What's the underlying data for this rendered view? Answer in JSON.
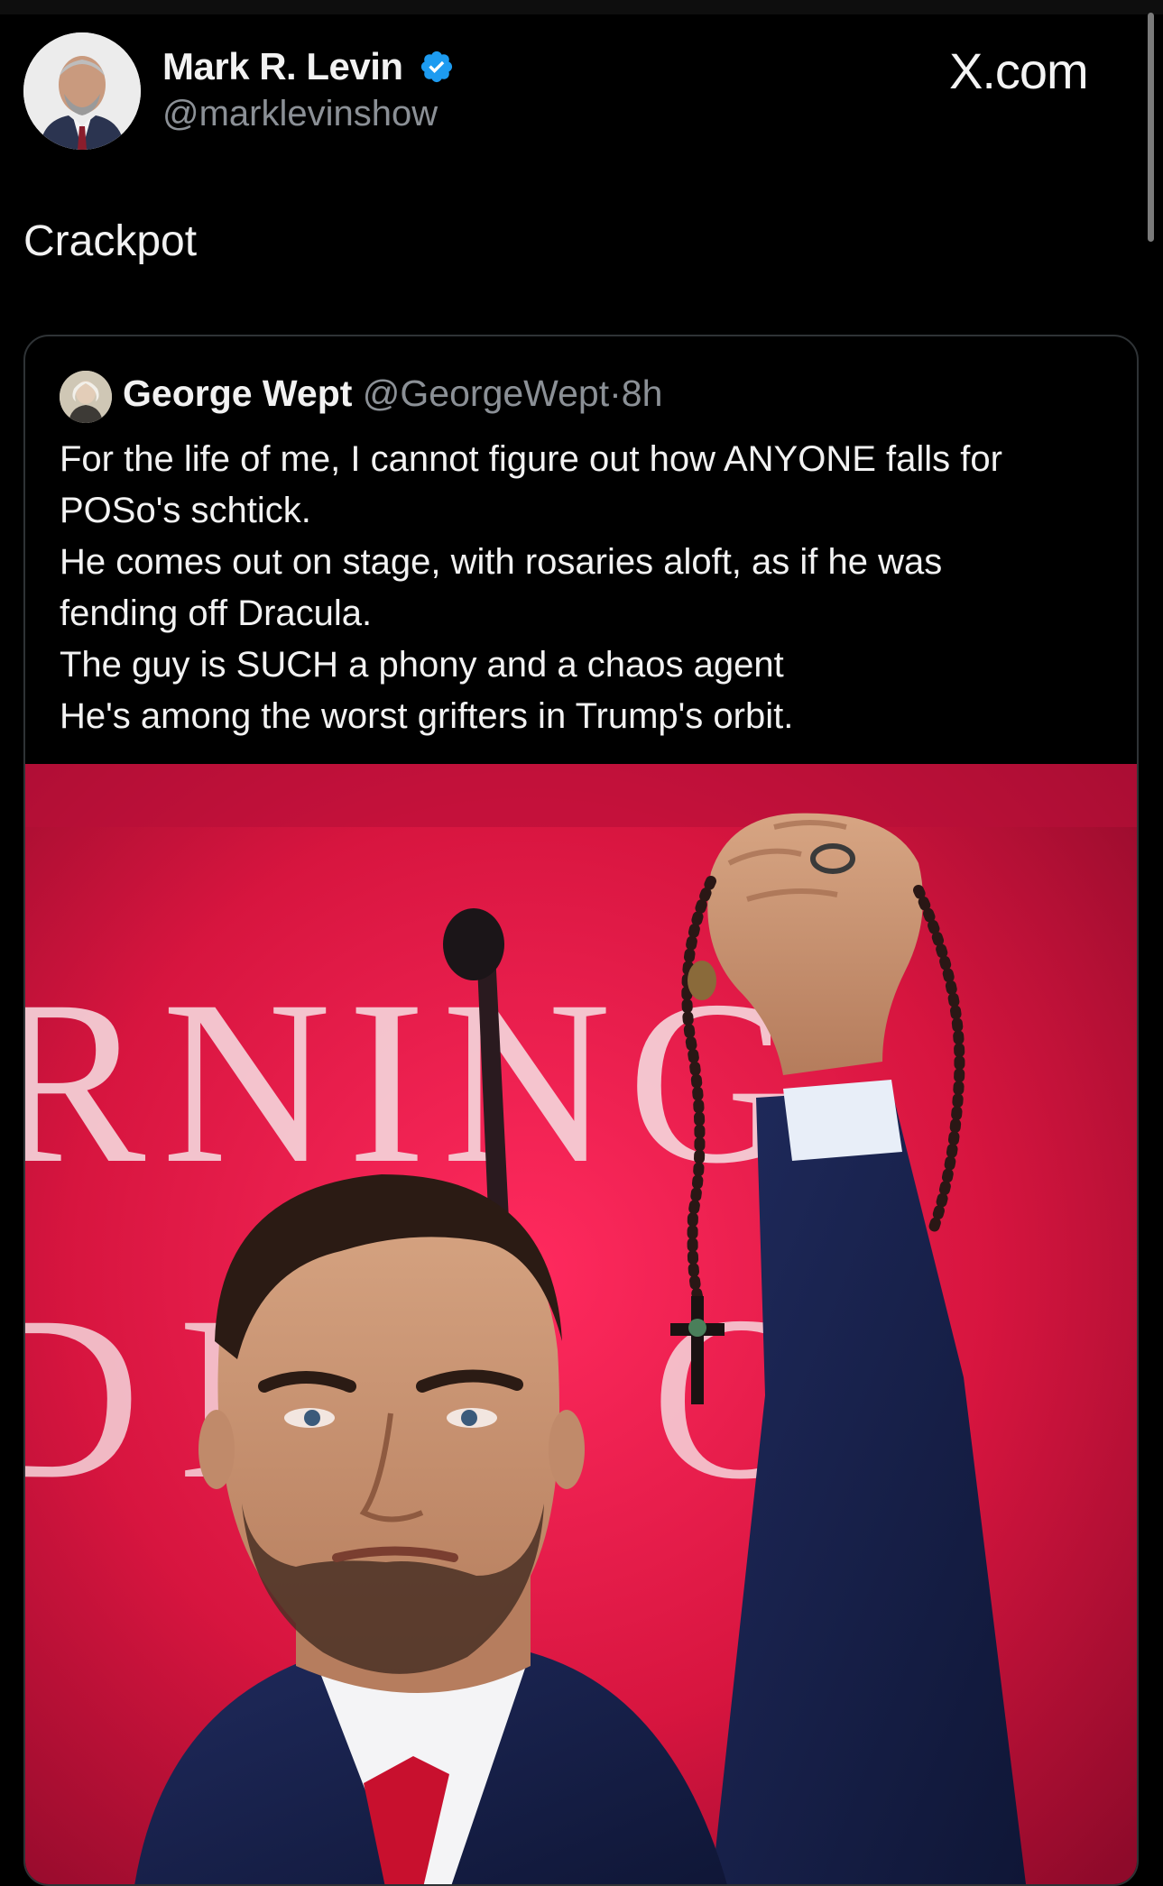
{
  "post": {
    "author_name": "Mark R. Levin",
    "author_handle": "@marklevinshow",
    "site_label": "X.com",
    "text": "Crackpot"
  },
  "quoted_post": {
    "author_name": "George Wept",
    "author_handle": "@GeorgeWept",
    "separator": "·",
    "time": "8h",
    "lines": [
      "For the life of me, I cannot figure out how ANYONE falls for",
      "POSo's schtick.",
      "He comes out on stage, with rosaries aloft, as if he was",
      "fending off Dracula.",
      "The guy is SUCH a phony and a chaos agent",
      "He's among the worst grifters in Trump's orbit."
    ],
    "image": {
      "background_letters_top": "RNING",
      "background_letters_bottom": "DI T C"
    }
  },
  "colors": {
    "background": "#000000",
    "text_primary": "#e7e9ea",
    "text_secondary": "#8b9096",
    "verified_blue": "#1d9bf0",
    "card_border": "#2f3336",
    "stage_red": "#c8123a"
  },
  "icons": {
    "verified": "verified-badge-icon"
  }
}
